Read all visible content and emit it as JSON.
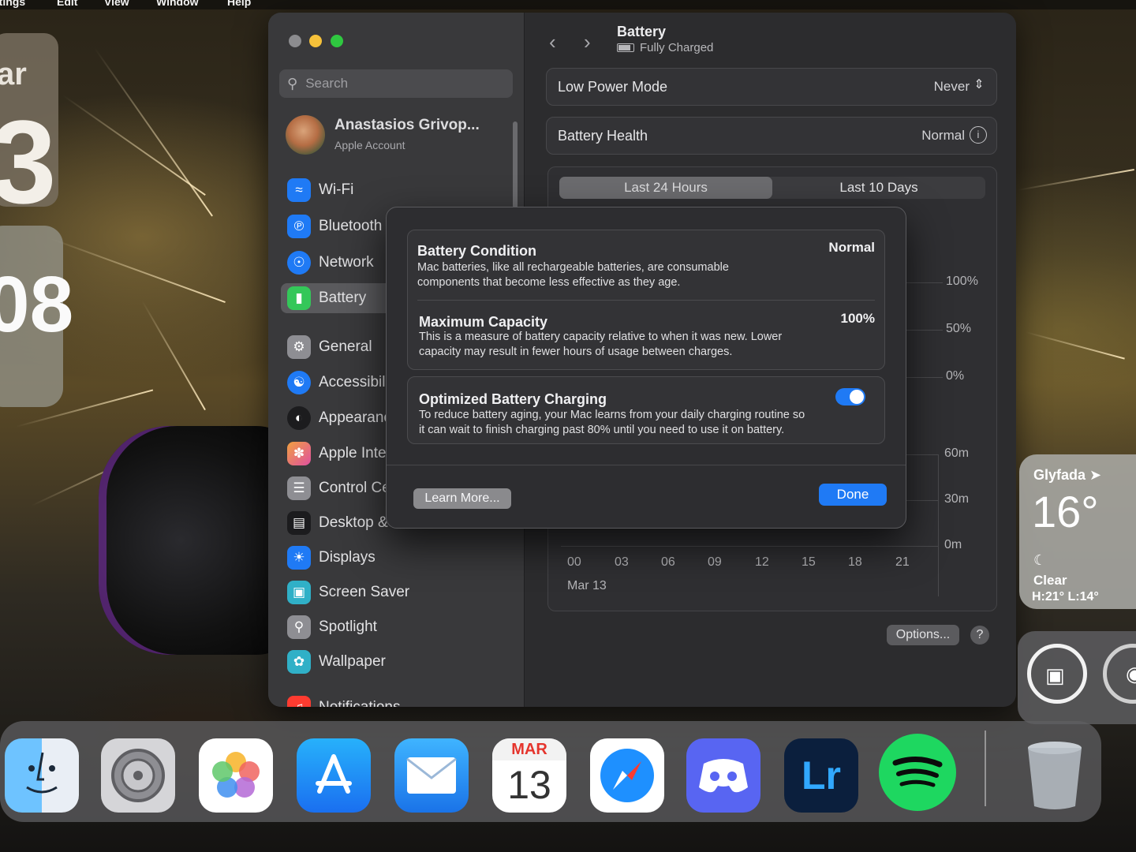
{
  "menubar": {
    "items": [
      "ttings",
      "Edit",
      "View",
      "Window",
      "Help"
    ]
  },
  "widgets": {
    "calendar": {
      "month_fragment": "ar",
      "day_fragment": "3"
    },
    "clock": {
      "time_fragment": "08"
    },
    "weather": {
      "city": "Glyfada",
      "temperature": "16°",
      "condition": "Clear",
      "high_low": "H:21° L:14°"
    }
  },
  "window": {
    "sidebar": {
      "search_placeholder": "Search",
      "account": {
        "name": "Anastasios Grivop...",
        "subtitle": "Apple Account"
      },
      "items": [
        {
          "label": "Wi-Fi",
          "icon": "wifi-icon",
          "color": "#1f7af5"
        },
        {
          "label": "Bluetooth",
          "icon": "bluetooth-icon",
          "color": "#1f7af5"
        },
        {
          "label": "Network",
          "icon": "globe-icon",
          "color": "#1f7af5"
        },
        {
          "label": "Battery",
          "icon": "battery-icon",
          "color": "#34c759",
          "selected": true
        },
        {
          "label": "General",
          "icon": "gear-icon",
          "color": "#8e8e93"
        },
        {
          "label": "Accessibility",
          "icon": "accessibility-icon",
          "color": "#1f7af5"
        },
        {
          "label": "Appearance",
          "icon": "appearance-icon",
          "color": "#1c1c1e"
        },
        {
          "label": "Apple Intelligence & Siri",
          "icon": "siri-icon",
          "color": "#e8734a"
        },
        {
          "label": "Control Centre",
          "icon": "control-centre-icon",
          "color": "#8e8e93"
        },
        {
          "label": "Desktop & Dock",
          "icon": "dock-icon",
          "color": "#1c1c1e"
        },
        {
          "label": "Displays",
          "icon": "sun-icon",
          "color": "#1f7af5"
        },
        {
          "label": "Screen Saver",
          "icon": "screen-saver-icon",
          "color": "#30b0c7"
        },
        {
          "label": "Spotlight",
          "icon": "magnifier-icon",
          "color": "#8e8e93"
        },
        {
          "label": "Wallpaper",
          "icon": "flower-icon",
          "color": "#30b0c7"
        },
        {
          "label": "Notifications",
          "icon": "bell-icon",
          "color": "#ff3b30"
        }
      ]
    },
    "main": {
      "title": "Battery",
      "subtitle": "Fully Charged",
      "low_power": {
        "label": "Low Power Mode",
        "value": "Never"
      },
      "battery_health": {
        "label": "Battery Health",
        "value": "Normal"
      },
      "tabs": [
        "Last 24 Hours",
        "Last 10 Days"
      ],
      "graph": {
        "level_axis": [
          "100%",
          "50%",
          "0%"
        ],
        "usage_axis": [
          "60m",
          "30m",
          "0m"
        ],
        "hours": [
          "00",
          "03",
          "06",
          "09",
          "12",
          "15",
          "18",
          "21"
        ],
        "date": "Mar 13"
      },
      "options_label": "Options...",
      "help_label": "?"
    }
  },
  "sheet": {
    "condition": {
      "title": "Battery Condition",
      "value": "Normal",
      "description_line1": "Mac batteries, like all rechargeable batteries, are consumable",
      "description_line2": "components that become less effective as they age."
    },
    "capacity": {
      "title": "Maximum Capacity",
      "value": "100%",
      "description_line1": "This is a measure of battery capacity relative to when it was new. Lower",
      "description_line2": "capacity may result in fewer hours of usage between charges."
    },
    "optimized": {
      "title": "Optimized Battery Charging",
      "enabled": true,
      "description_line1": "To reduce battery aging, your Mac learns from your daily charging routine so",
      "description_line2": "it can wait to finish charging past 80% until you need to use it on battery."
    },
    "learn_more": "Learn More...",
    "done": "Done"
  },
  "dock": {
    "apps": [
      {
        "name": "Finder",
        "icon": "finder-icon"
      },
      {
        "name": "System Settings",
        "icon": "settings-icon"
      },
      {
        "name": "Photos",
        "icon": "photos-icon"
      },
      {
        "name": "App Store",
        "icon": "app-store-icon"
      },
      {
        "name": "Mail",
        "icon": "mail-icon"
      },
      {
        "name": "Calendar",
        "icon": "calendar-icon",
        "month": "MAR",
        "day": "13"
      },
      {
        "name": "Safari",
        "icon": "safari-icon"
      },
      {
        "name": "Discord",
        "icon": "discord-icon"
      },
      {
        "name": "Lightroom",
        "icon": "lightroom-icon",
        "text": "Lr"
      },
      {
        "name": "Spotify",
        "icon": "spotify-icon"
      },
      {
        "name": "Trash",
        "icon": "trash-icon"
      }
    ]
  }
}
